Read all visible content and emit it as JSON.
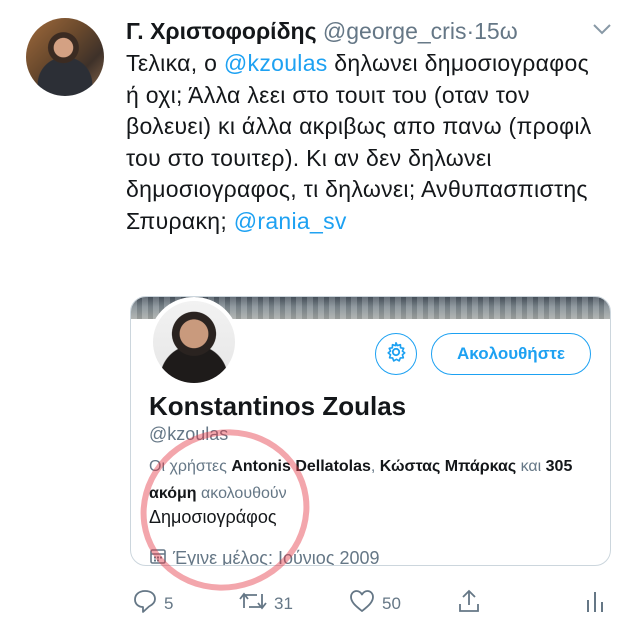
{
  "tweet": {
    "author_name": "Γ. Χριστοφορίδης",
    "author_handle": "@george_cris",
    "dot": "·",
    "time": "15ω",
    "text_part1": "Τελικα, ο ",
    "mention1": "@kzoulas",
    "text_part2": " δηλωνει δημοσιογραφος ή οχι; Άλλα λεει στο τουιτ του (οταν τον βολευει) κι άλλα ακριβως απο πανω (προφιλ του στο τουιτερ). Κι αν δεν δηλωνει δημοσιογραφος, τι δηλωνει; Ανθυπασπιστης Σπυρακη; ",
    "mention2": "@rania_sv"
  },
  "card": {
    "follow_label": "Ακολουθήστε",
    "name": "Konstantinos Zoulas",
    "handle": "@kzoulas",
    "followers_prefix": "Οι χρήστες ",
    "follower1": "Antonis Dellatolas",
    "follower_sep": ", ",
    "follower2": "Κώστας Μπάρκας",
    "followers_and": " και ",
    "followers_more": "305 ακόμη",
    "followers_suffix": " ακολουθούν",
    "bio": "Δημοσιογράφος",
    "joined": "Έγινε μέλος: Ιούνιος 2009"
  },
  "actions": {
    "replies": "5",
    "retweets": "31",
    "likes": "50"
  },
  "icons": [
    "chevron-down-icon",
    "gear-icon",
    "calendar-icon",
    "reply-icon",
    "retweet-icon",
    "like-icon",
    "share-icon",
    "analytics-icon"
  ],
  "colors": {
    "accent": "#1da1f2",
    "muted": "#657786",
    "text": "#14171a",
    "annotation": "#e53946"
  }
}
